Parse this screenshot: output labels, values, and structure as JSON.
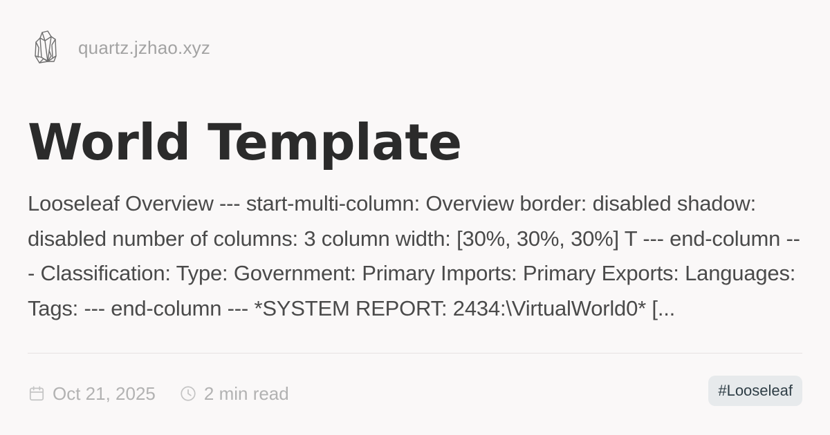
{
  "site": {
    "name": "quartz.jzhao.xyz",
    "logo_icon": "quartz-crystal-icon"
  },
  "page": {
    "title": "World Template",
    "description": "Looseleaf Overview --- start-multi-column: Overview border: disabled shadow: disabled number of columns: 3 column width: [30%, 30%, 30%] T --- end-column --- Classification: Type: Government: Primary Imports: Primary Exports: Languages: Tags: --- end-column --- *SYSTEM REPORT: 2434:\\VirtualWorld0* [..."
  },
  "meta": {
    "date": "Oct 21, 2025",
    "date_icon": "calendar-icon",
    "reading_time": "2 min read",
    "reading_time_icon": "clock-icon"
  },
  "tags": [
    "#Looseleaf"
  ],
  "colors": {
    "background": "#faf8f8",
    "title": "#2b2b2b",
    "body_text": "#4a4a4a",
    "muted_text": "#a3a3a3",
    "tag_background": "#e7eaec",
    "tag_text": "#2f3e46"
  }
}
